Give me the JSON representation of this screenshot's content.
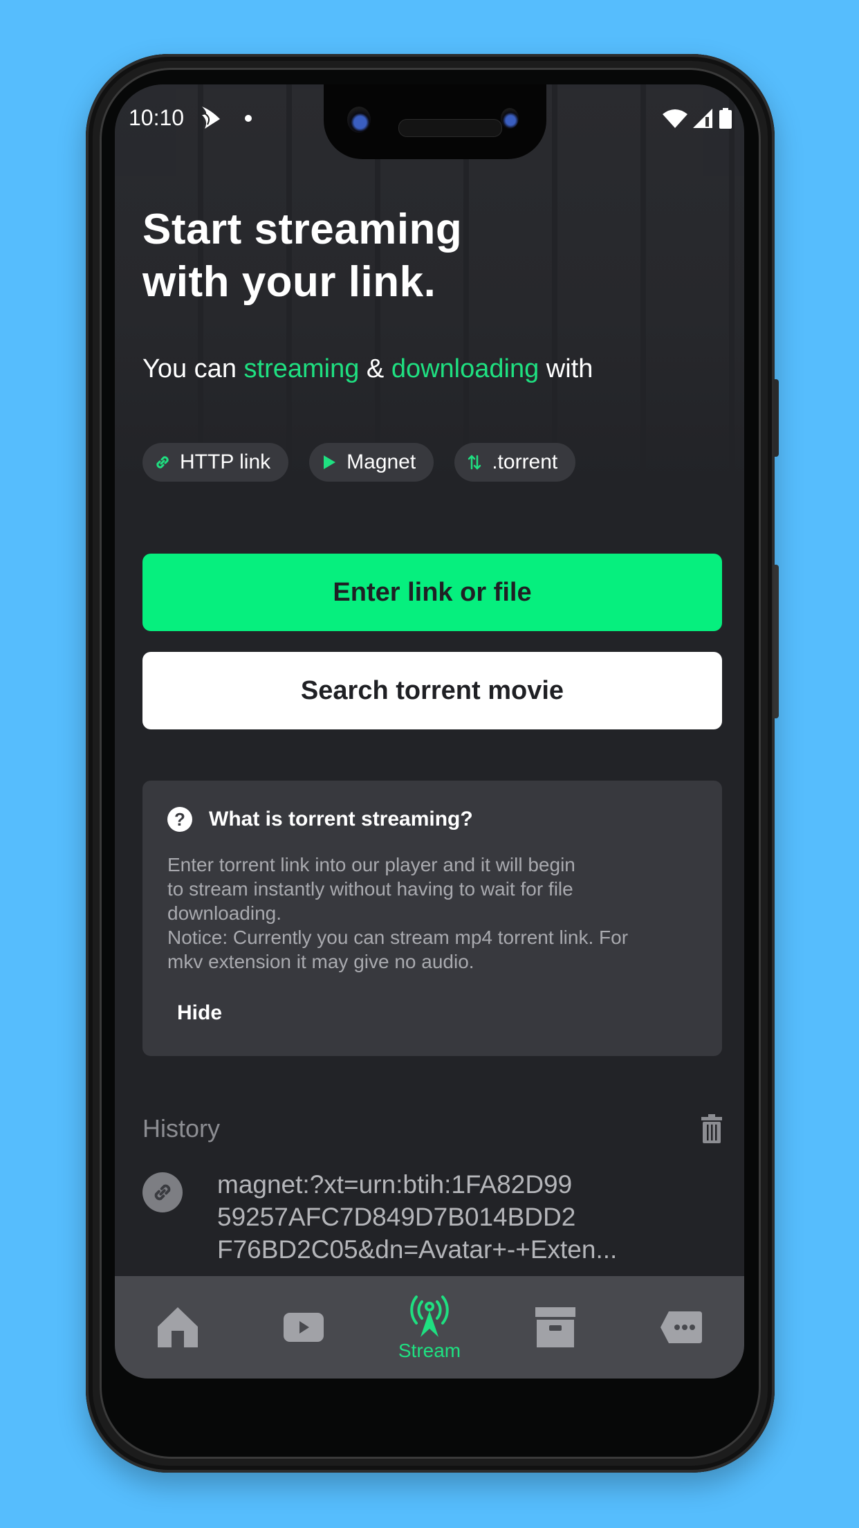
{
  "status_bar": {
    "time": "10:10",
    "icons": [
      "app-notification-icon",
      "dot-icon",
      "wifi-icon",
      "cell-signal-icon",
      "battery-icon"
    ]
  },
  "hero": {
    "title": "Start streaming\nwith your link.",
    "subtitle_prefix": "You can ",
    "subtitle_accent1": "streaming",
    "subtitle_mid": " & ",
    "subtitle_accent2": "downloading",
    "subtitle_suffix": " with"
  },
  "chips": [
    {
      "label": "HTTP link",
      "icon": "link-icon"
    },
    {
      "label": "Magnet",
      "icon": "play-icon"
    },
    {
      "label": ".torrent",
      "icon": "swap-vertical-icon"
    }
  ],
  "buttons": {
    "primary": "Enter link or file",
    "secondary": "Search torrent movie"
  },
  "info_card": {
    "title": "What is torrent streaming?",
    "body": "Enter torrent link into our player and it will begin\nto stream instantly without having to wait for file\ndownloading.\nNotice: Currently you can stream mp4 torrent link. For\nmkv extension it may give no audio.",
    "hide_label": "Hide"
  },
  "history": {
    "label": "History",
    "items": [
      {
        "text": "magnet:?xt=urn:btih:1FA82D99\n59257AFC7D849D7B014BDD2\nF76BD2C05&dn=Avatar+-+Exten...",
        "date": ""
      }
    ]
  },
  "nav": {
    "items": [
      {
        "name": "home",
        "icon": "home-icon",
        "label": ""
      },
      {
        "name": "videos",
        "icon": "play-box-icon",
        "label": ""
      },
      {
        "name": "stream",
        "icon": "broadcast-tower-icon",
        "label": "Stream",
        "active": true
      },
      {
        "name": "archive",
        "icon": "archive-box-icon",
        "label": ""
      },
      {
        "name": "more",
        "icon": "more-tag-icon",
        "label": ""
      }
    ]
  },
  "colors": {
    "accent": "#06ef7e",
    "accent_text": "#1fe081",
    "background": "#222327",
    "card": "#38393e",
    "nav_bar": "#48494e",
    "page_background": "#56bdfd"
  }
}
